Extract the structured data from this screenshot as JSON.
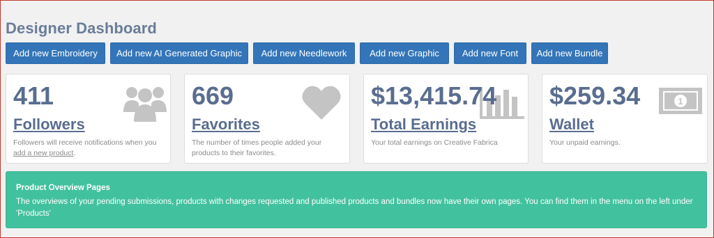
{
  "header": {
    "title": "Designer Dashboard"
  },
  "buttons": [
    {
      "label": "Add new Embroidery"
    },
    {
      "label": "Add new AI Generated Graphic"
    },
    {
      "label": "Add new Needlework"
    },
    {
      "label": "Add new Graphic"
    },
    {
      "label": "Add new Font"
    },
    {
      "label": "Add new Bundle"
    }
  ],
  "cards": {
    "followers": {
      "value": "411",
      "label": "Followers",
      "desc_prefix": "Followers will receive notifications when you ",
      "desc_link": "add a new product",
      "desc_suffix": ".",
      "icon": "users-icon"
    },
    "favorites": {
      "value": "669",
      "label": "Favorites",
      "desc": "The number of times people added your products to their favorites.",
      "icon": "heart-icon"
    },
    "earnings": {
      "value": "$13,415.74",
      "label": "Total Earnings",
      "desc": "Your total earnings on Creative Fabrica",
      "icon": "bar-chart-icon"
    },
    "wallet": {
      "value": "$259.34",
      "label": "Wallet",
      "desc": "Your unpaid earnings.",
      "icon": "money-bill-icon"
    }
  },
  "banner": {
    "title": "Product Overview Pages",
    "text": "The overviews of your pending submissions, products with changes requested and published products and bundles now have their own pages. You can find them in the menu on the left under 'Products'"
  },
  "colors": {
    "accent": "#3375b8",
    "title": "#6a7d99",
    "card_text": "#596d8f",
    "icon": "#c4c4c4",
    "banner": "#42c19e"
  }
}
